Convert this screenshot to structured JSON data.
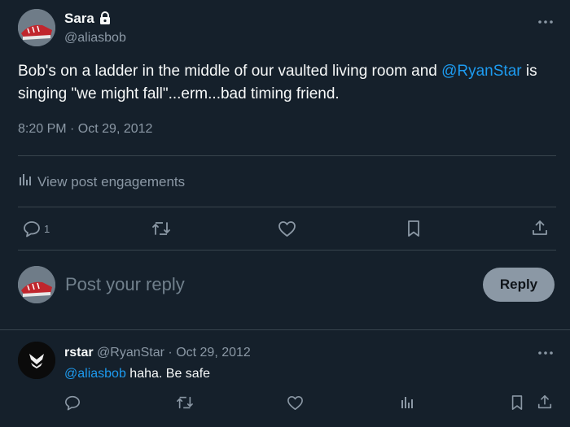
{
  "post": {
    "author_name": "Sara",
    "author_handle": "@aliasbob",
    "text_before": "Bob's on a ladder in the middle of our vaulted living room and ",
    "mention": "@RyanStar",
    "text_after": " is singing \"we might fall\"...erm...bad timing friend.",
    "timestamp": "8:20 PM · Oct 29, 2012",
    "engagements_label": "View post engagements",
    "reply_count": "1"
  },
  "composer": {
    "placeholder": "Post your reply",
    "reply_label": "Reply"
  },
  "reply": {
    "author_name": "rstar",
    "author_handle": "@RyanStar",
    "date": "· Oct 29, 2012",
    "mention": "@aliasbob",
    "text": " haha.  Be safe"
  },
  "icons": {
    "lock": "lock-icon",
    "more": "more-icon",
    "reply": "reply-icon",
    "repost": "repost-icon",
    "like": "like-icon",
    "bookmark": "bookmark-icon",
    "share": "share-icon",
    "analytics": "analytics-icon"
  },
  "colors": {
    "background": "#15202b",
    "link": "#1d9bf0",
    "muted": "#8b98a5",
    "divider": "#38444d"
  }
}
